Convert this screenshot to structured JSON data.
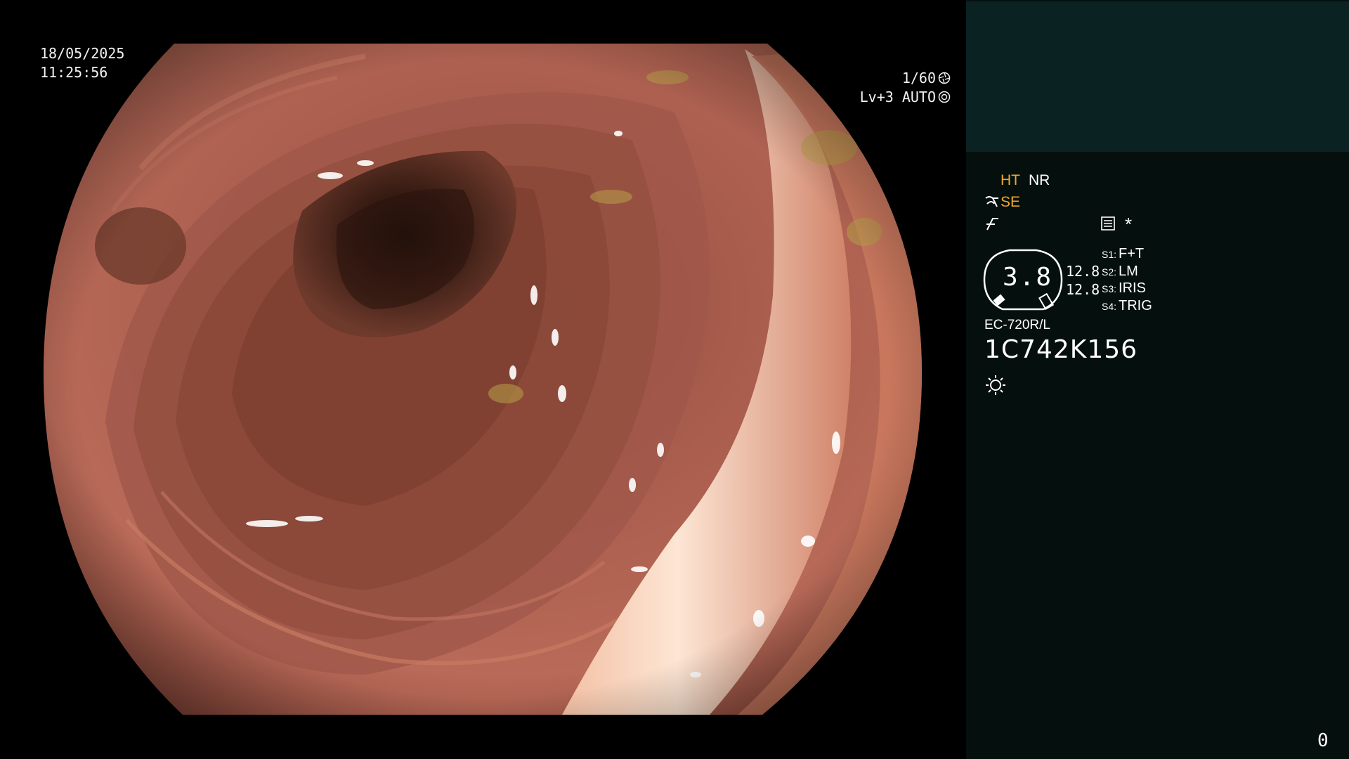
{
  "overlay": {
    "date": "18/05/2025",
    "time": "11:25:56",
    "shutter": "1/60",
    "shutter_icon": "shutter-icon",
    "level": "Lv+3",
    "iris_mode": "AUTO",
    "iris_icon": "iris-icon"
  },
  "panel": {
    "mode_ht": "HT",
    "mode_nr": "NR",
    "mode_se": "SE",
    "se_icon": "structure-enhancement-icon",
    "edge_icon": "edge-enhancement-icon",
    "menu_icon": "menu-list-icon",
    "asterisk": "*",
    "gauge_value": "3.8",
    "value_a": "12.8",
    "value_b": "12.8",
    "switches": [
      {
        "prefix": "S1:",
        "label": "F+T"
      },
      {
        "prefix": "S2:",
        "label": "LM"
      },
      {
        "prefix": "S3:",
        "label": "IRIS"
      },
      {
        "prefix": "S4:",
        "label": "TRIG"
      }
    ],
    "scope_model": "EC-720R/L",
    "scope_serial": "1C742K156",
    "light_icon": "light-source-icon",
    "counter": "0"
  },
  "colors": {
    "panel_bg": "#040f0e",
    "panel_top_bg": "#0b2223",
    "accent_amber": "#f0a82a",
    "mucosa": "#b8685a"
  }
}
